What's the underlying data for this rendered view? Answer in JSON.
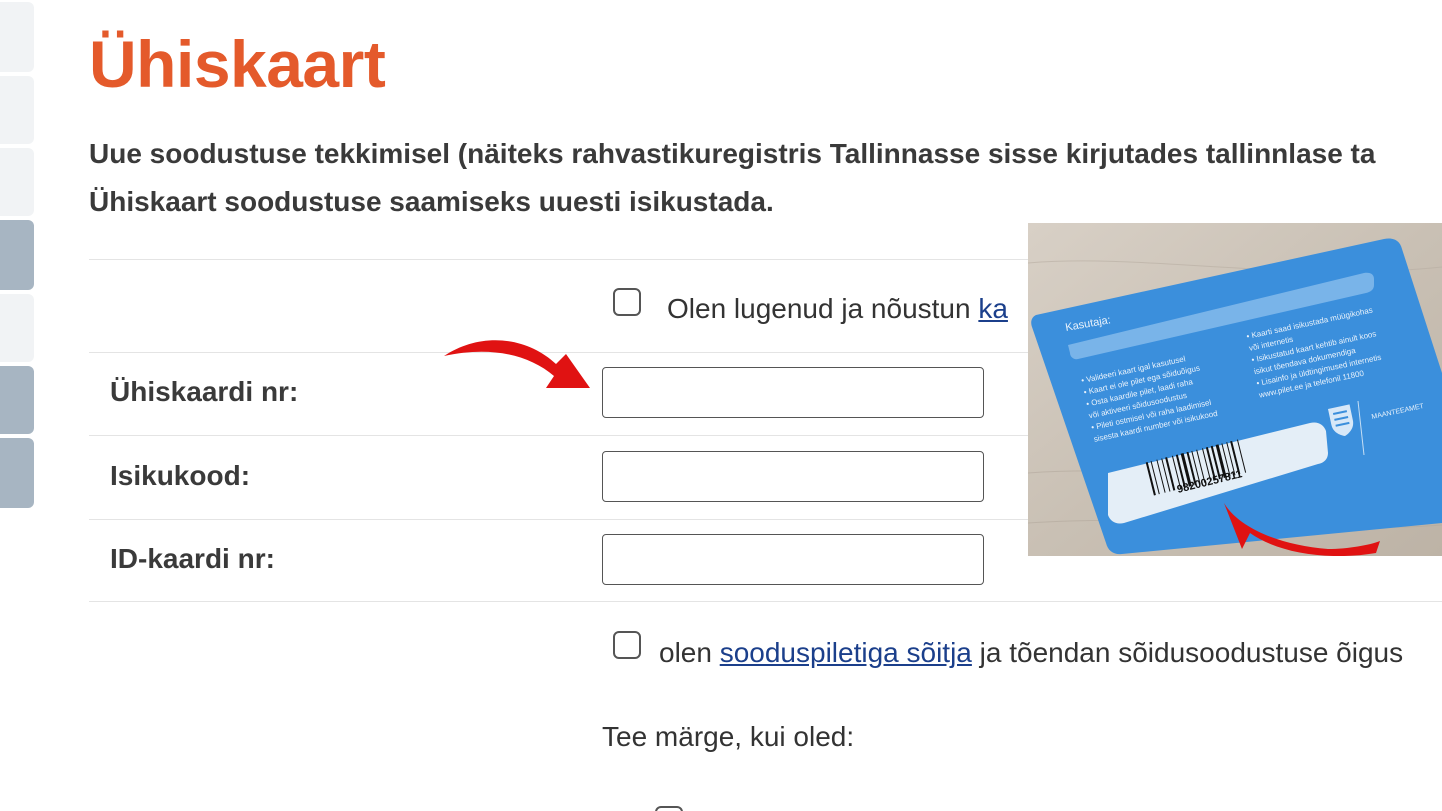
{
  "page": {
    "title": "Ühiskaart",
    "intro_line1": "Uue soodustuse tekkimisel (näiteks rahvastikuregistris Tallinnasse sisse kirjutades tallinnlase ta",
    "intro_line2": "Ühiskaart soodustuse saamiseks uuesti isikustada."
  },
  "terms": {
    "text": "Olen lugenud ja nõustun ",
    "link": "ka"
  },
  "form": {
    "card_number_label": "Ühiskaardi nr:",
    "card_number_value": "",
    "personal_code_label": "Isikukood:",
    "personal_code_value": "",
    "id_card_label": "ID-kaardi nr:",
    "id_card_value": ""
  },
  "discount": {
    "text_before": "olen ",
    "link": "sooduspiletiga sõitja",
    "text_after": " ja tõendan sõidusoodustuse õigus"
  },
  "mark_prompt": "Tee märge, kui oled:",
  "card_photo": {
    "user_label": "Kasutaja:",
    "left_rules": [
      "• Valideeri kaart igal kasutusel",
      "• Kaart ei ole pilet ega sõiduõigus",
      "• Osta kaardile pilet, laadi raha",
      "  või aktiveeri sõidusoodustus",
      "• Pileti ostmisel või raha laadimisel",
      "  sisesta kaardi number või isikukood"
    ],
    "right_rules": [
      "• Kaarti saad isikustada müügikohas",
      "  või internetis",
      "• Isikustatud kaart kehtib ainult koos",
      "  isikut tõendava dokumendiga",
      "• Lisainfo ja üldtingimused internetis",
      "  www.pilet.ee ja telefonil 11800"
    ],
    "barcode_number": "98200257811",
    "agency": "MAANTEEAMET"
  },
  "colors": {
    "title": "#e45a2b",
    "link": "#1b3f8b",
    "arrow": "#e01212",
    "card": "#3b8fdc"
  }
}
